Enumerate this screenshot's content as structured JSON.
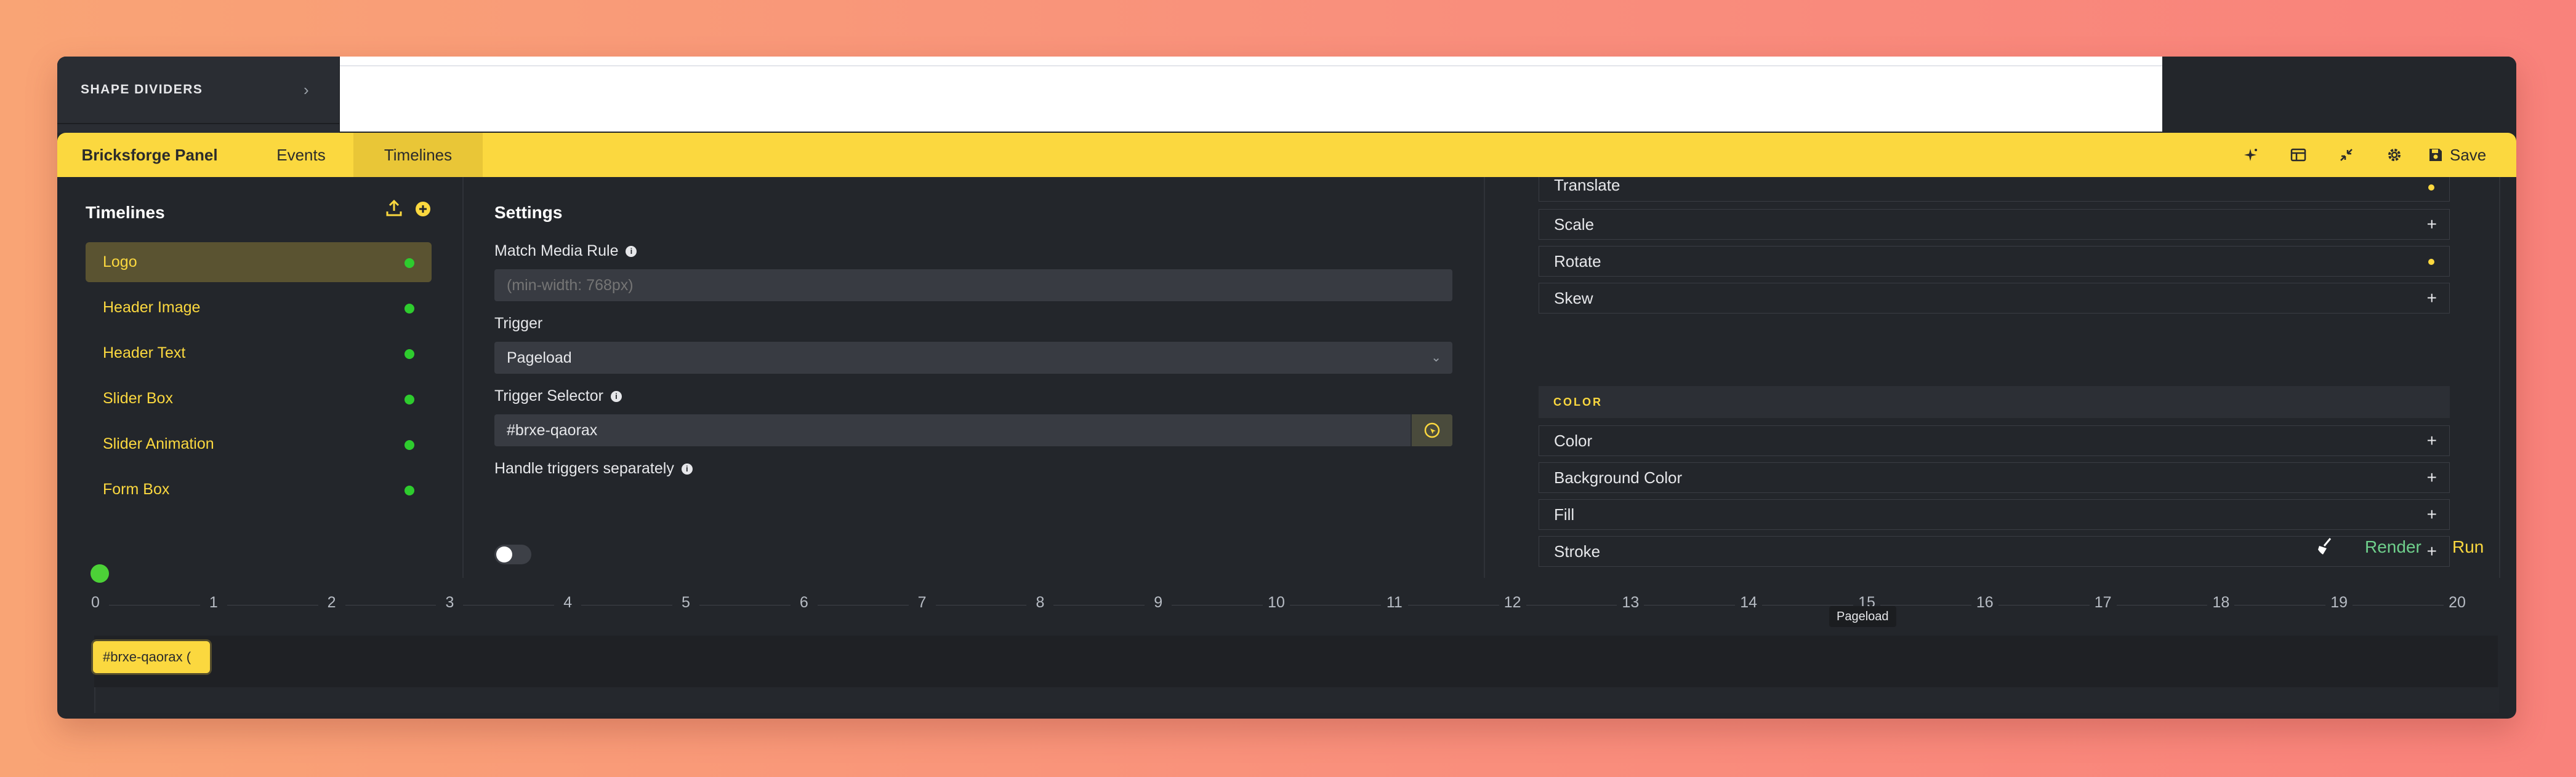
{
  "builder": {
    "shape_dividers_label": "SHAPE DIVIDERS"
  },
  "tabbar": {
    "brand": "Bricksforge Panel",
    "tabs": [
      "Events",
      "Timelines"
    ],
    "save_label": "Save"
  },
  "timelines": {
    "title": "Timelines",
    "items": [
      "Logo",
      "Header Image",
      "Header Text",
      "Slider Box",
      "Slider Animation",
      "Form Box"
    ]
  },
  "settings": {
    "title": "Settings",
    "match_media_label": "Match Media Rule",
    "match_media_placeholder": "(min-width: 768px)",
    "trigger_label": "Trigger",
    "trigger_value": "Pageload",
    "trigger_selector_label": "Trigger Selector",
    "trigger_selector_value": "#brxe-qaorax",
    "handle_triggers_label": "Handle triggers separately"
  },
  "properties": {
    "transform": [
      {
        "name": "Translate",
        "mark": "dot"
      },
      {
        "name": "Scale",
        "mark": "+"
      },
      {
        "name": "Rotate",
        "mark": "dot"
      },
      {
        "name": "Skew",
        "mark": "+"
      }
    ],
    "color_section": "COLOR",
    "color": [
      {
        "name": "Color",
        "mark": "+"
      },
      {
        "name": "Background Color",
        "mark": "+"
      },
      {
        "name": "Fill",
        "mark": "+"
      },
      {
        "name": "Stroke",
        "mark": "+"
      }
    ]
  },
  "timeline_area": {
    "render_label": "Render",
    "run_label": "Run",
    "ticks": [
      "0",
      "1",
      "2",
      "3",
      "4",
      "5",
      "6",
      "7",
      "8",
      "9",
      "10",
      "11",
      "12",
      "13",
      "14",
      "15",
      "16",
      "17",
      "18",
      "19",
      "20"
    ],
    "tooltip": "Pageload",
    "chip_label": "#brxe-qaorax (",
    "colors": {
      "accent": "#fbd83f",
      "status": "#2ecc2e",
      "render": "#6fd08c"
    }
  }
}
